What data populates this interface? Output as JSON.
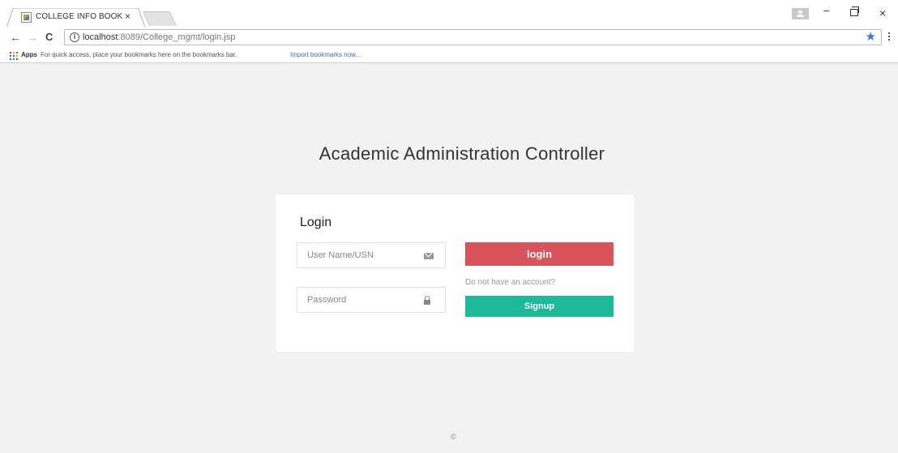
{
  "browser": {
    "tab_title": "COLLEGE INFO BOOK",
    "tab_close": "×",
    "url_host": "localhost",
    "url_rest": ":8089/College_mgmt/login.jsp",
    "info_glyph": "i",
    "star_glyph": "★",
    "nav": {
      "back": "←",
      "forward": "→",
      "reload": "C"
    },
    "window": {
      "minimize": "–",
      "close": "×"
    },
    "bookmarks": {
      "apps_label": "Apps",
      "hint": "For quick access, place your bookmarks here on the bookmarks bar.",
      "import_link": "Import bookmarks now..."
    },
    "accent_color": "#3b78e7"
  },
  "page": {
    "heading": "Academic Administration Controller",
    "login_card": {
      "title": "Login",
      "username_placeholder": "User Name/USN",
      "password_placeholder": "Password",
      "login_button": "login",
      "no_account_text": "Do not have an account?",
      "signup_button": "Signup",
      "login_color": "#d9545a",
      "signup_color": "#1db999"
    },
    "footer": "©"
  }
}
